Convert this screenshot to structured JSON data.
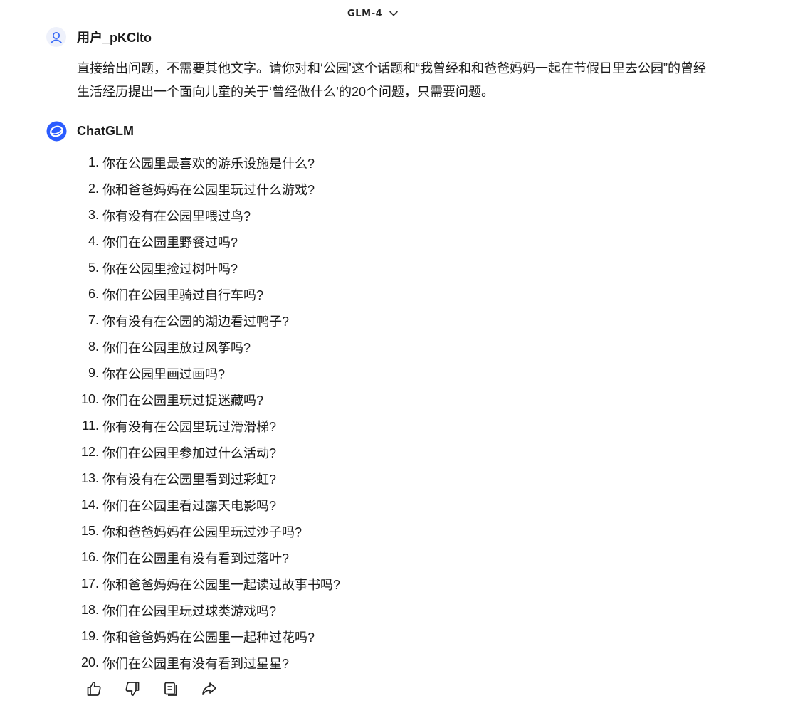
{
  "header": {
    "model_name": "GLM-4",
    "model_dropdown_icon": "chevron-down-icon"
  },
  "user_message": {
    "avatar_icon": "user-avatar-icon",
    "username": "用户_pKClto",
    "text": "直接给出问题，不需要其他文字。请你对和‘公园’这个话题和“我曾经和和爸爸妈妈一起在节假日里去公园”的曾经生活经历提出一个面向儿童的关于‘曾经做什么’的20个问题，只需要问题。"
  },
  "bot_message": {
    "avatar_icon": "chatglm-logo-icon",
    "name": "ChatGLM",
    "items": [
      {
        "num": "1.",
        "text": "你在公园里最喜欢的游乐设施是什么?"
      },
      {
        "num": "2.",
        "text": "你和爸爸妈妈在公园里玩过什么游戏?"
      },
      {
        "num": "3.",
        "text": "你有没有在公园里喂过鸟?"
      },
      {
        "num": "4.",
        "text": "你们在公园里野餐过吗?"
      },
      {
        "num": "5.",
        "text": "你在公园里捡过树叶吗?"
      },
      {
        "num": "6.",
        "text": "你们在公园里骑过自行车吗?"
      },
      {
        "num": "7.",
        "text": "你有没有在公园的湖边看过鸭子?"
      },
      {
        "num": "8.",
        "text": "你们在公园里放过风筝吗?"
      },
      {
        "num": "9.",
        "text": "你在公园里画过画吗?"
      },
      {
        "num": "10.",
        "text": "你们在公园里玩过捉迷藏吗?"
      },
      {
        "num": "11.",
        "text": "你有没有在公园里玩过滑滑梯?"
      },
      {
        "num": "12.",
        "text": "你们在公园里参加过什么活动?"
      },
      {
        "num": "13.",
        "text": "你有没有在公园里看到过彩虹?"
      },
      {
        "num": "14.",
        "text": "你们在公园里看过露天电影吗?"
      },
      {
        "num": "15.",
        "text": "你和爸爸妈妈在公园里玩过沙子吗?"
      },
      {
        "num": "16.",
        "text": "你们在公园里有没有看到过落叶?"
      },
      {
        "num": "17.",
        "text": "你和爸爸妈妈在公园里一起读过故事书吗?"
      },
      {
        "num": "18.",
        "text": "你们在公园里玩过球类游戏吗?"
      },
      {
        "num": "19.",
        "text": "你和爸爸妈妈在公园里一起种过花吗?"
      },
      {
        "num": "20.",
        "text": "你们在公园里有没有看到过星星?"
      }
    ]
  },
  "actions": [
    {
      "icon": "thumbs-up-icon"
    },
    {
      "icon": "thumbs-down-icon"
    },
    {
      "icon": "copy-icon"
    },
    {
      "icon": "share-icon"
    }
  ],
  "colors": {
    "brand_blue": "#2b5cff",
    "text": "#1a1a1a",
    "avatar_bg": "#eef1fb",
    "avatar_fg": "#3b6cf6"
  }
}
